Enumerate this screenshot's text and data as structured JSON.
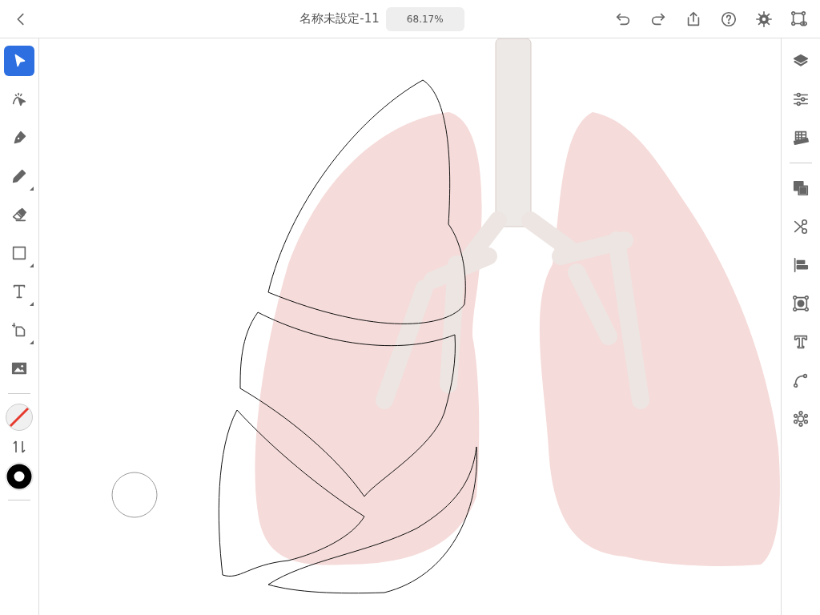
{
  "top_bar": {
    "title": "名称未設定-11",
    "zoom": "68.17%"
  },
  "tools": [
    {
      "selected": true,
      "more": false
    },
    {
      "selected": false,
      "more": false
    },
    {
      "selected": false,
      "more": false
    },
    {
      "selected": false,
      "more": true
    },
    {
      "selected": false,
      "more": false
    },
    {
      "selected": false,
      "more": true
    },
    {
      "selected": false,
      "more": true
    },
    {
      "selected": false,
      "more": true
    },
    {
      "selected": false,
      "more": false
    }
  ]
}
